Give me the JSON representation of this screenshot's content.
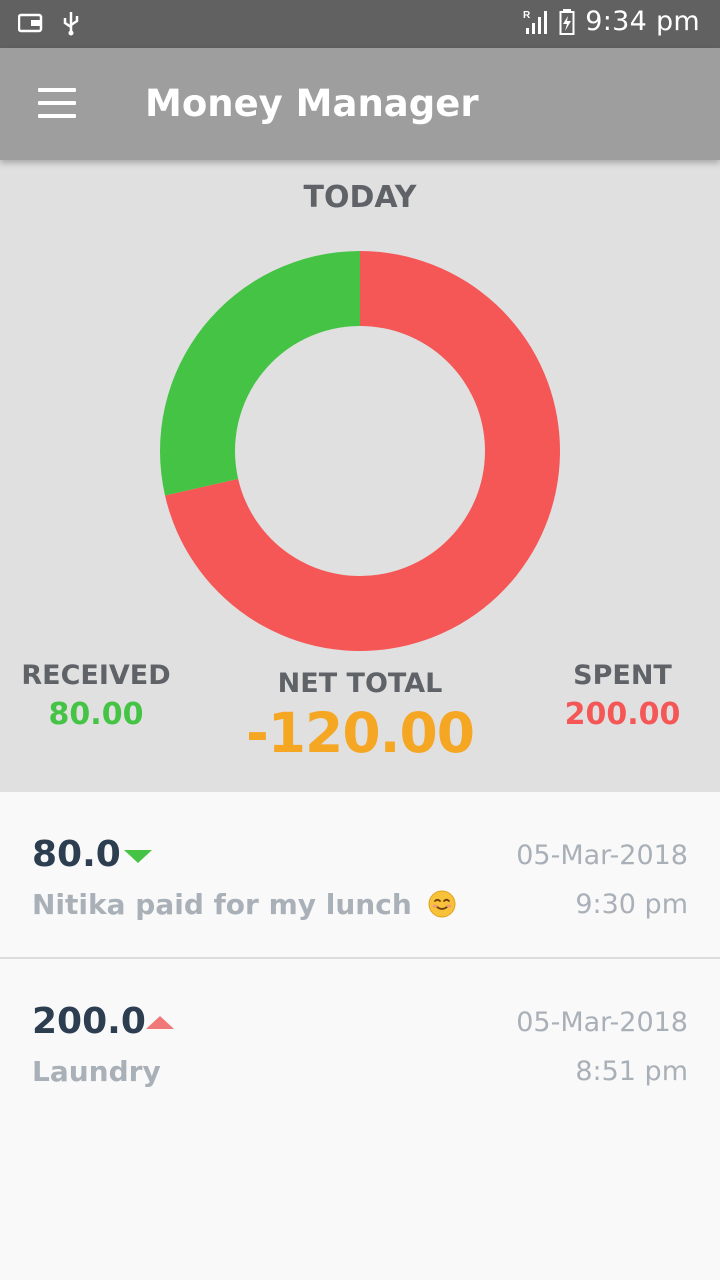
{
  "status_bar": {
    "time": "9:34 pm",
    "icons_left": [
      "wallet-icon",
      "usb-icon"
    ],
    "icons_right": [
      "signal-icon",
      "battery-charging-icon"
    ]
  },
  "app_bar": {
    "title": "Money Manager",
    "menu_icon": "hamburger-menu-icon"
  },
  "summary": {
    "period": "TODAY",
    "received_label": "RECEIVED",
    "received_value": "80.00",
    "spent_label": "SPENT",
    "spent_value": "200.00",
    "net_label": "NET TOTAL",
    "net_value": "-120.00"
  },
  "colors": {
    "received": "#45c345",
    "spent": "#f55656",
    "net": "#f5a623"
  },
  "chart_data": {
    "type": "pie",
    "categories": [
      "Received",
      "Spent"
    ],
    "values": [
      80,
      200
    ],
    "colors": [
      "#45c345",
      "#f55656"
    ],
    "donut": true
  },
  "transactions": [
    {
      "amount": "80.0",
      "direction": "received",
      "arrow_icon": "arrow-down-icon",
      "description": "Nitika paid for my lunch",
      "emoji": "smiling-face-icon",
      "date": "05-Mar-2018",
      "time": "9:30 pm"
    },
    {
      "amount": "200.0",
      "direction": "spent",
      "arrow_icon": "arrow-up-icon",
      "description": "Laundry",
      "date": "05-Mar-2018",
      "time": "8:51 pm"
    }
  ]
}
